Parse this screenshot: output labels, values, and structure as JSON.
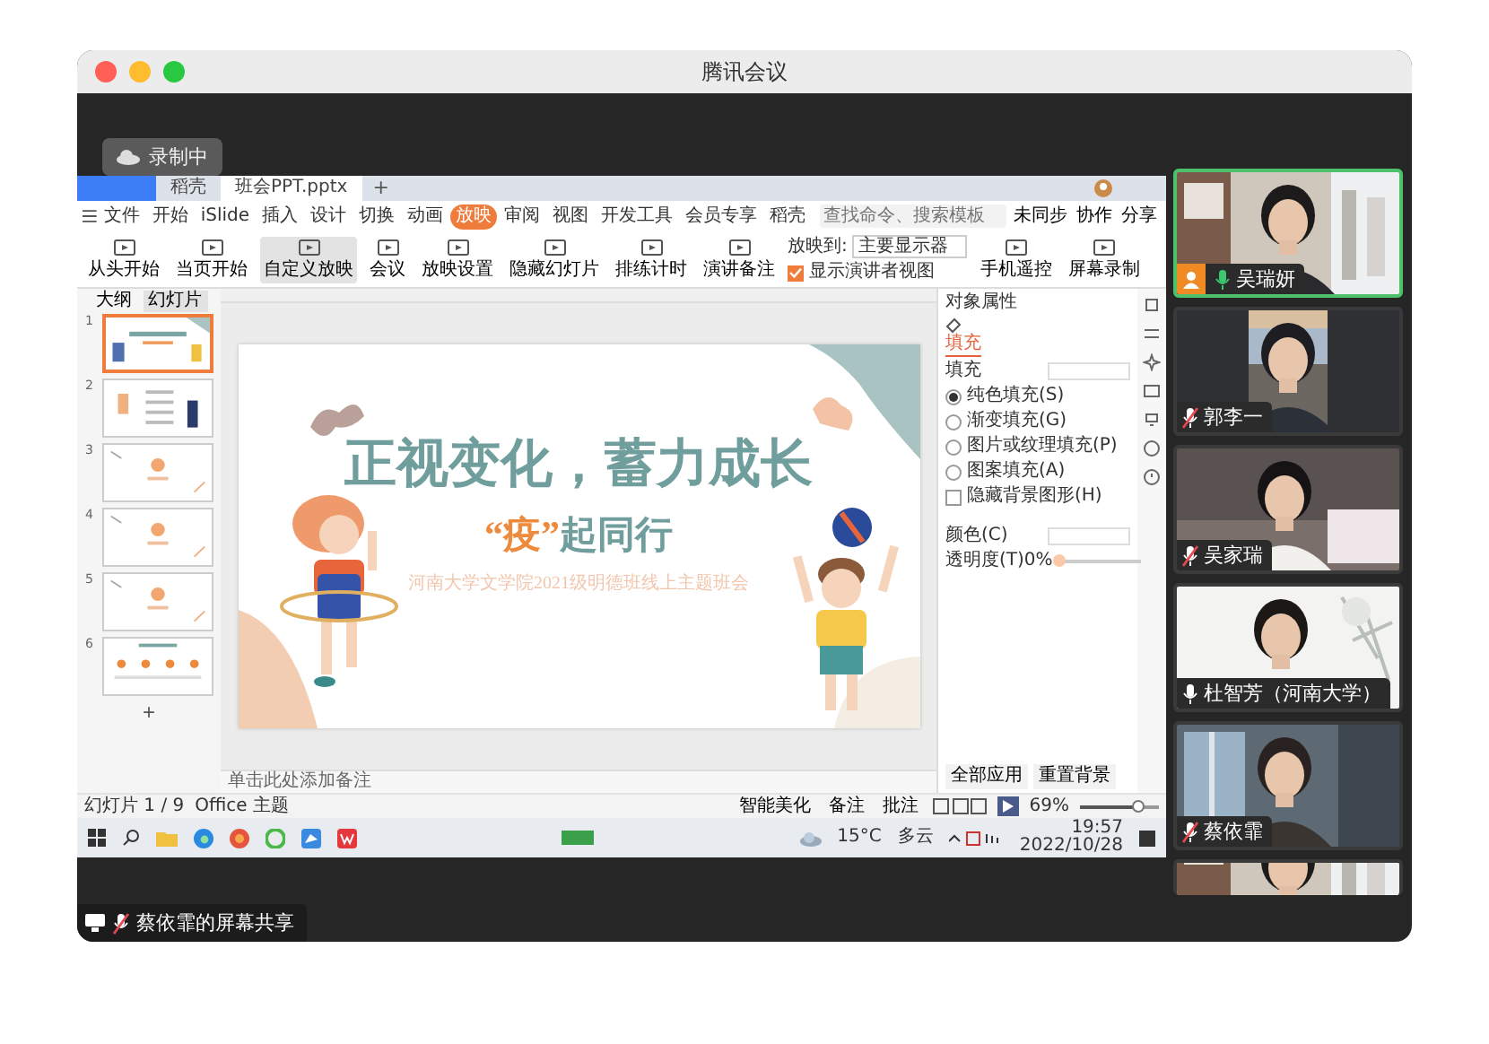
{
  "window": {
    "title": "腾讯会议"
  },
  "recording": {
    "label": "录制中"
  },
  "wps": {
    "tabs": [
      {
        "label": "稻壳",
        "selected": false
      },
      {
        "label": "班会PPT.pptx",
        "selected": true
      }
    ],
    "new_tab": "+",
    "menu": [
      {
        "label": "文件",
        "selected": false
      },
      {
        "label": "开始",
        "selected": false
      },
      {
        "label": "iSlide",
        "selected": false
      },
      {
        "label": "插入",
        "selected": false
      },
      {
        "label": "设计",
        "selected": false
      },
      {
        "label": "切换",
        "selected": false
      },
      {
        "label": "动画",
        "selected": false
      },
      {
        "label": "放映",
        "selected": true
      },
      {
        "label": "审阅",
        "selected": false
      },
      {
        "label": "视图",
        "selected": false
      },
      {
        "label": "开发工具",
        "selected": false
      },
      {
        "label": "会员专享",
        "selected": false
      },
      {
        "label": "稻壳",
        "selected": false
      }
    ],
    "search": {
      "placeholder": "查找命令、搜索模板"
    },
    "actions": [
      "未同步",
      "协作",
      "分享"
    ],
    "ribbon": [
      {
        "label": "从头开始",
        "selected": false
      },
      {
        "label": "当页开始",
        "selected": false
      },
      {
        "label": "自定义放映",
        "selected": true
      },
      {
        "label": "会议",
        "selected": false
      },
      {
        "label": "放映设置",
        "selected": false
      },
      {
        "label": "隐藏幻灯片",
        "selected": false
      },
      {
        "label": "排练计时",
        "selected": false
      },
      {
        "label": "演讲备注",
        "selected": false
      }
    ],
    "display_select": {
      "label": "放映到:",
      "value": "主要显示器"
    },
    "presenter_view": {
      "label": "显示演讲者视图",
      "checked": true
    },
    "ribbon_extra": [
      {
        "label": "手机遥控",
        "selected": false
      },
      {
        "label": "屏幕录制",
        "selected": false
      }
    ],
    "panel_tabs": [
      {
        "label": "大纲",
        "selected": false
      },
      {
        "label": "幻灯片",
        "selected": true
      }
    ],
    "thumbnails": [
      {
        "number": "1",
        "kind": "cover",
        "selected": true
      },
      {
        "number": "2",
        "kind": "agenda",
        "selected": false
      },
      {
        "number": "3",
        "kind": "section",
        "selected": false
      },
      {
        "number": "4",
        "kind": "section",
        "selected": false
      },
      {
        "number": "5",
        "kind": "section",
        "selected": false
      },
      {
        "number": "6",
        "kind": "timeline",
        "selected": false
      }
    ],
    "add_slide": "+",
    "slide": {
      "title": "正视变化，蓄力成长",
      "subtitle": "**“疫”**起同行",
      "caption": "河南大学文学院2021级明德班线上主题班会"
    },
    "notes": {
      "placeholder": "单击此处添加备注"
    },
    "properties": {
      "title": "对象属性",
      "tab": "填充",
      "section": "填充",
      "fill_options": [
        {
          "label": "纯色填充(S)",
          "selected": true
        },
        {
          "label": "渐变填充(G)",
          "selected": false
        },
        {
          "label": "图片或纹理填充(P)",
          "selected": false
        },
        {
          "label": "图案填充(A)",
          "selected": false
        }
      ],
      "hide_graphics": {
        "label": "隐藏背景图形(H)",
        "checked": false
      },
      "color_label": "颜色(C)",
      "opacity": {
        "label": "透明度(T)",
        "reading": "0%",
        "level": 0
      },
      "buttons": [
        "全部应用",
        "重置背景"
      ]
    },
    "status": {
      "slide": "幻灯片 1 / 9",
      "theme": "Office 主题",
      "beautify": "智能美化",
      "notes": "备注",
      "comments": "批注",
      "zoom": {
        "reading": "69%",
        "level": 0.75
      }
    },
    "taskbar": {
      "temperature": "15°C",
      "weather": "多云",
      "time": "19:57",
      "date": "2022/10/28"
    }
  },
  "share_label": "蔡依霏的屏幕共享",
  "participants": [
    {
      "kind": "video",
      "name": "吴瑞妍",
      "muted": false,
      "speaking": true,
      "host": true
    },
    {
      "kind": "video",
      "name": "郭李一",
      "muted": true,
      "speaking": false,
      "host": false
    },
    {
      "kind": "video",
      "name": "吴家瑞",
      "muted": true,
      "speaking": false,
      "host": false
    },
    {
      "kind": "video",
      "name": "杜智芳（河南大学）",
      "muted": false,
      "speaking": false,
      "host": false
    },
    {
      "kind": "video",
      "name": "蔡依霏",
      "muted": true,
      "speaking": false,
      "host": false
    },
    {
      "kind": "partial"
    }
  ]
}
